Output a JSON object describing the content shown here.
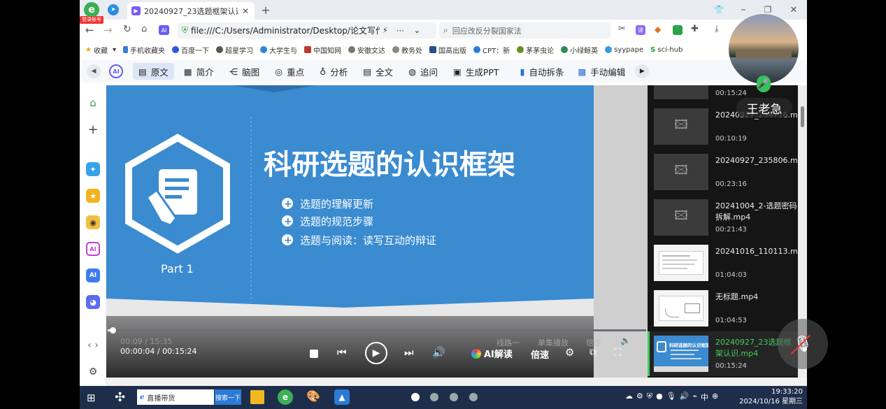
{
  "browser": {
    "account_badge": "登录账号",
    "tab_title": "20240927_23选题框架认识.m",
    "url": "file:///C:/Users/Administrator/Desktop/论文写作指",
    "search_placeholder": "回应改反分裂国家法"
  },
  "bookmarks": [
    {
      "label": "收藏",
      "color": "#f0a000"
    },
    {
      "label": "手机收藏夹",
      "color": "#3a7bd5"
    },
    {
      "label": "百度一下",
      "color": "#2a5ad8"
    },
    {
      "label": "超星学习",
      "color": "#555"
    },
    {
      "label": "大学生与",
      "color": "#2f86d6"
    },
    {
      "label": "中国知网",
      "color": "#c0392b"
    },
    {
      "label": "安徽文达",
      "color": "#777"
    },
    {
      "label": "教务处",
      "color": "#888"
    },
    {
      "label": "国高出版",
      "color": "#2a4d8f"
    },
    {
      "label": "CPT：新",
      "color": "#2a7fd4"
    },
    {
      "label": "茅茅虫论",
      "color": "#6b8e23"
    },
    {
      "label": "小绿鲸英",
      "color": "#2e8b57"
    },
    {
      "label": "syypape",
      "color": "#3a9ad9"
    },
    {
      "label": "sci-hub",
      "color": "#2a9d3a"
    }
  ],
  "ai_toolbar": {
    "items": [
      "原文",
      "简介",
      "脑图",
      "重点",
      "分析",
      "全文",
      "追问",
      "生成PPT",
      "自动拆条",
      "手动编辑"
    ]
  },
  "slide": {
    "title": "科研选题的认识框架",
    "part_label": "Part 1",
    "bullets": [
      "选题的理解更新",
      "选题的规范步骤",
      "选题与阅读：读写互动的辩证"
    ]
  },
  "player": {
    "ghost_time": "00:09 / 15:35",
    "ghost_labels": [
      "线路一",
      "单集播放",
      "倍速"
    ],
    "current_time": "00:00:04",
    "total_time": "00:15:24",
    "time_separator": "/",
    "progress": 0.004,
    "ai_label": "AI解读",
    "speed_label": "倍速"
  },
  "playlist": [
    {
      "name": "",
      "duration": "00:15:24",
      "thumb": "blank"
    },
    {
      "name": "20240927_234716.mp4",
      "duration": "00:10:19",
      "thumb": "blank"
    },
    {
      "name": "20240927_235806.mp4",
      "duration": "00:23:16",
      "thumb": "blank"
    },
    {
      "name": "20241004_2-选题密码拆解.mp4",
      "duration": "00:21:43",
      "thumb": "blank"
    },
    {
      "name": "20241016_110113.mp4",
      "duration": "01:04:03",
      "thumb": "doc"
    },
    {
      "name": "无标题.mp4",
      "duration": "01:04:53",
      "thumb": "doc"
    },
    {
      "name": "20240927_23选题框架认识.mp4",
      "duration": "00:15:24",
      "thumb": "slide",
      "active": true
    }
  ],
  "thumb_title": "科研选题的认识框架",
  "overlay": {
    "user_name": "王老急"
  },
  "taskbar": {
    "search_text": "直播带货",
    "search_button": "搜索一下",
    "ime": "中",
    "time": "19:33:20",
    "date": "2024/10/16 星期三"
  },
  "colors": {
    "slide_blue": "#3a8bd0",
    "active_green": "#3fcf5f",
    "toolbar_active": "#dce6f7"
  }
}
